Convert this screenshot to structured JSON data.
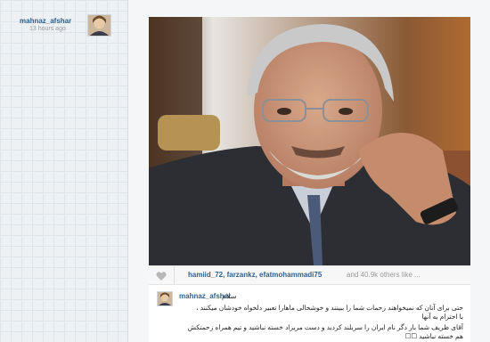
{
  "author": {
    "name": "mahnaz_afshar",
    "time": "13 hours ago"
  },
  "likes": {
    "names": "hamiid_72, farzankz, efatmohammadi75",
    "others": "and 40.9k others like ..."
  },
  "caption": {
    "user": "mahnaz_afshar",
    "greeting": "سلام",
    "line1": "حتی برای آنان که نمیخواهند زحمات شما را ببینند و خوشحالی ماهارا تعبیر دلخواه خودشان میکنند ،",
    "line2": "با احترام به آنها",
    "line3": "آقای ظریف شما بار دگر نام ایران را سربلند کردید و دست مریزاد خسته نباشید و تیم همراه زحمتکش",
    "line4": "هم خسته نباشید ☐☐"
  },
  "colors": {
    "link": "#2f5f8c",
    "muted": "#999999",
    "background": "#eef1f4"
  },
  "icons": {
    "like": "heart-icon"
  }
}
